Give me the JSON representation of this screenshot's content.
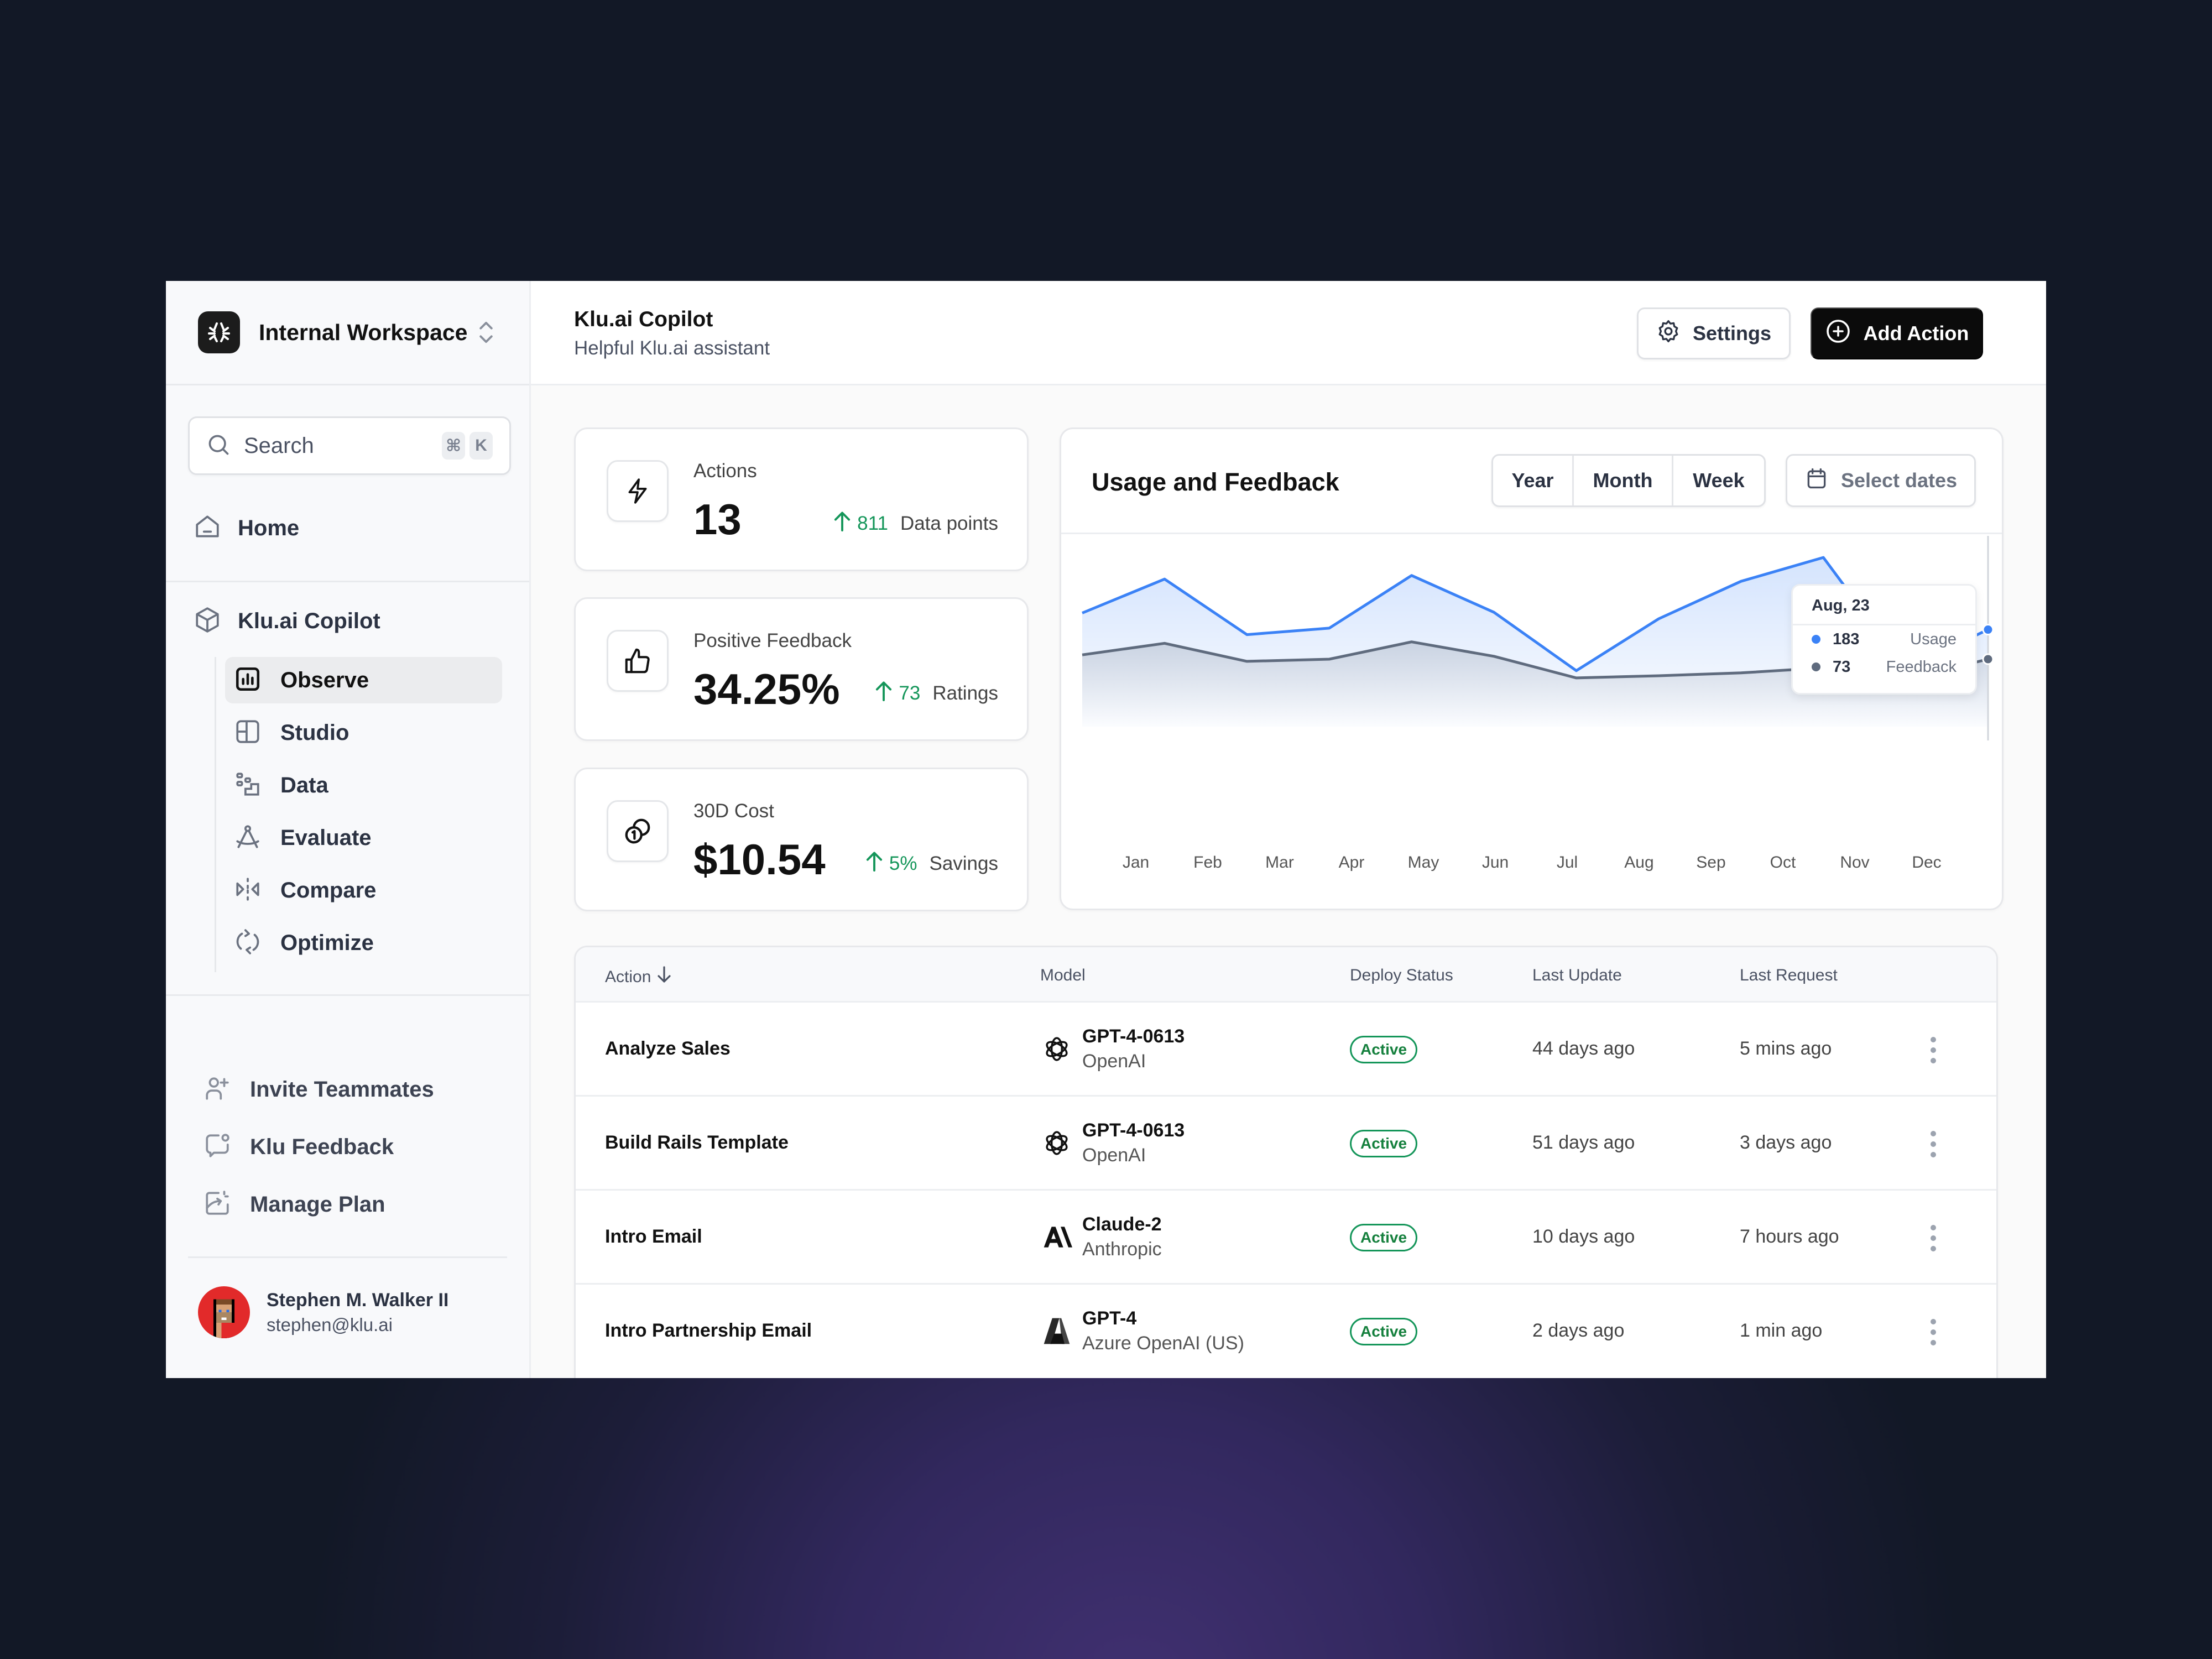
{
  "workspace": {
    "name": "Internal Workspace",
    "logo_icon": "klu-logo-icon",
    "switcher_icon": "chevron-up-down-icon"
  },
  "search": {
    "placeholder": "Search",
    "shortcut_keys": [
      "⌘",
      "K"
    ]
  },
  "sidebar": {
    "home": {
      "label": "Home",
      "icon": "home-icon"
    },
    "project": {
      "label": "Klu.ai Copilot",
      "icon": "cube-icon"
    },
    "items": [
      {
        "label": "Observe",
        "icon": "bar-chart-icon",
        "active": true
      },
      {
        "label": "Studio",
        "icon": "layout-icon",
        "active": false
      },
      {
        "label": "Data",
        "icon": "data-icon",
        "active": false
      },
      {
        "label": "Evaluate",
        "icon": "compass-icon",
        "active": false
      },
      {
        "label": "Compare",
        "icon": "compare-icon",
        "active": false
      },
      {
        "label": "Optimize",
        "icon": "refresh-icon",
        "active": false
      }
    ],
    "bottom_items": [
      {
        "label": "Invite Teammates",
        "icon": "user-plus-icon"
      },
      {
        "label": "Klu Feedback",
        "icon": "message-icon"
      },
      {
        "label": "Manage Plan",
        "icon": "plan-icon"
      }
    ],
    "user": {
      "name": "Stephen M. Walker II",
      "email": "stephen@klu.ai"
    }
  },
  "header": {
    "title": "Klu.ai Copilot",
    "subtitle": "Helpful Klu.ai assistant",
    "settings_label": "Settings",
    "add_action_label": "Add Action"
  },
  "stats": [
    {
      "label": "Actions",
      "value": "13",
      "delta": "811",
      "delta_unit": "Data points",
      "icon": "lightning-icon"
    },
    {
      "label": "Positive Feedback",
      "value": "34.25%",
      "delta": "73",
      "delta_unit": "Ratings",
      "icon": "thumbs-up-icon"
    },
    {
      "label": "30D Cost",
      "value": "$10.54",
      "delta": "5%",
      "delta_unit": "Savings",
      "icon": "coins-icon"
    }
  ],
  "colors": {
    "usage": "#3b82f6",
    "feedback": "#5f6b7e",
    "positive": "#15965a",
    "primary_button": "#0b0b0b"
  },
  "chart_controls": {
    "title": "Usage and Feedback",
    "ranges": [
      "Year",
      "Month",
      "Week"
    ],
    "date_picker_label": "Select dates"
  },
  "tooltip": {
    "date": "Aug, 23",
    "rows": [
      {
        "value": "183",
        "name": "Usage"
      },
      {
        "value": "73",
        "name": "Feedback"
      }
    ]
  },
  "chart_data": {
    "type": "area",
    "title": "Usage and Feedback",
    "xlabel": "",
    "ylabel": "",
    "categories": [
      "Jan",
      "Feb",
      "Mar",
      "Apr",
      "May",
      "Jun",
      "Jul",
      "Aug",
      "Sep",
      "Oct",
      "Nov",
      "Dec"
    ],
    "series": [
      {
        "name": "Usage",
        "values": [
          143,
          190,
          113,
          122,
          195,
          144,
          63,
          135,
          187,
          220,
          66,
          120
        ]
      },
      {
        "name": "Feedback",
        "values": [
          85,
          101,
          76,
          79,
          103,
          83,
          53,
          56,
          60,
          67,
          51,
          79
        ]
      }
    ],
    "ylim": [
      0,
      250
    ],
    "grid": false,
    "legend": "none",
    "highlighted_index": 11
  },
  "table": {
    "columns": [
      "Action",
      "Model",
      "Deploy Status",
      "Last Update",
      "Last Request"
    ],
    "sort_icon": "arrow-down-icon",
    "rows": [
      {
        "action": "Analyze Sales",
        "model": "GPT-4-0613",
        "provider": "OpenAI",
        "logo": "openai-logo-icon",
        "status": "Active",
        "last_update": "44 days ago",
        "last_request": "5 mins ago"
      },
      {
        "action": "Build Rails Template",
        "model": "GPT-4-0613",
        "provider": "OpenAI",
        "logo": "openai-logo-icon",
        "status": "Active",
        "last_update": "51 days ago",
        "last_request": "3 days ago"
      },
      {
        "action": "Intro Email",
        "model": "Claude-2",
        "provider": "Anthropic",
        "logo": "anthropic-logo-icon",
        "status": "Active",
        "last_update": "10 days ago",
        "last_request": "7 hours ago"
      },
      {
        "action": "Intro Partnership Email",
        "model": "GPT-4",
        "provider": "Azure OpenAI (US)",
        "logo": "azure-logo-icon",
        "status": "Active",
        "last_update": "2 days ago",
        "last_request": "1 min ago"
      }
    ]
  }
}
